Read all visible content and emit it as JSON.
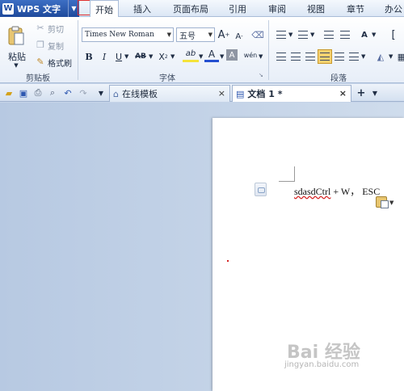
{
  "app": {
    "logo": "W",
    "title": "WPS 文字",
    "arrow": "▼"
  },
  "menu_tabs": [
    {
      "label": "开始",
      "active": true
    },
    {
      "label": "插入"
    },
    {
      "label": "页面布局"
    },
    {
      "label": "引用"
    },
    {
      "label": "审阅"
    },
    {
      "label": "视图"
    },
    {
      "label": "章节"
    },
    {
      "label": "办公"
    }
  ],
  "ribbon": {
    "clipboard": {
      "paste": "粘贴",
      "cut": "剪切",
      "copy": "复制",
      "format_painter": "格式刷",
      "group_label": "剪贴板"
    },
    "font": {
      "font_name": "Times New Roman",
      "font_size": "五号",
      "grow": "A",
      "shrink": "A",
      "bold": "B",
      "italic": "I",
      "underline": "U",
      "strike": "AB",
      "superscript": "X",
      "highlight": "ab",
      "font_color": "A",
      "char_shade": "A",
      "phonetic": "wén",
      "group_label": "字体"
    },
    "paragraph": {
      "group_label": "段落"
    }
  },
  "tabs": [
    {
      "label": "在线模板",
      "close": "×"
    },
    {
      "label": "文档 1 *",
      "close": "×"
    }
  ],
  "new_tab": "+",
  "document": {
    "text_error": "sdasdCtrl",
    "text_rest": "+ W， ESC"
  },
  "watermark": {
    "brand": "Bai 经验",
    "url": "jingyan.baidu.com"
  },
  "colors": {
    "accent": "#1f4a9c",
    "ribbon_bg": "#e7eef8",
    "workspace_bg": "#c6d4e8"
  }
}
